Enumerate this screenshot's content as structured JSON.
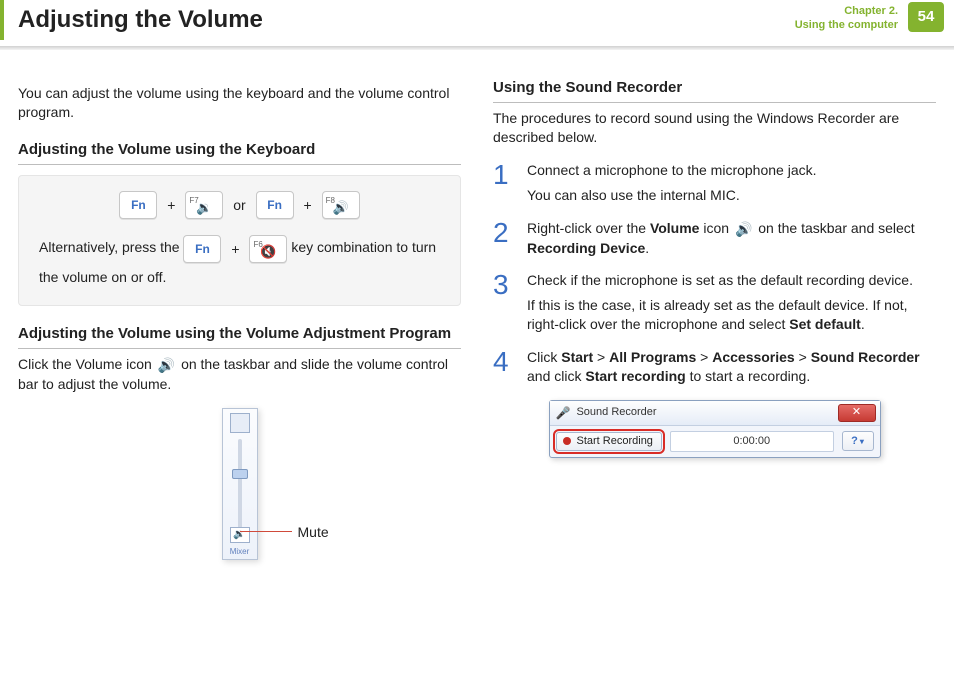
{
  "header": {
    "title": "Adjusting the Volume",
    "chapter_line1": "Chapter 2.",
    "chapter_line2": "Using the computer",
    "page": "54"
  },
  "left": {
    "intro": "You can adjust the volume using the keyboard and the volume control program.",
    "h1": "Adjusting the Volume using the Keyboard",
    "keys": {
      "fn": "Fn",
      "f7": "F7",
      "f8": "F8",
      "f6": "F6",
      "plus": "+",
      "or": "or"
    },
    "alt_pre": "Alternatively, press the ",
    "alt_post": " key combination to turn the volume on or off.",
    "h2": "Adjusting the Volume using the Volume Adjustment Program",
    "prog_pre": "Click the Volume icon ",
    "prog_post": " on the taskbar and slide the volume control bar to adjust the volume.",
    "mixer": "Mixer",
    "mute": "Mute"
  },
  "right": {
    "h1": "Using the Sound Recorder",
    "intro": "The procedures to record sound using the Windows Recorder are described below.",
    "steps": {
      "s1a": "Connect a microphone to the microphone jack.",
      "s1b": "You can also use the internal MIC.",
      "s2_pre": "Right-click over the ",
      "s2_vol": "Volume",
      "s2_mid": " icon ",
      "s2_post": " on the taskbar and select ",
      "s2_rd": "Recording Device",
      "s2_end": ".",
      "s3a": "Check if the microphone is set as the default recording device.",
      "s3b_pre": "If this is the case, it is already set as the default device. If not, right-click over the microphone and select ",
      "s3b_sd": "Set default",
      "s3b_end": ".",
      "s4_pre": "Click ",
      "s4_p1": "Start",
      "gt": " > ",
      "s4_p2": "All Programs",
      "s4_p3": "Accessories",
      "s4_p4": "Sound Recorder",
      "s4_mid": " and click ",
      "s4_p5": "Start recording",
      "s4_end": " to start a recording."
    },
    "nums": {
      "n1": "1",
      "n2": "2",
      "n3": "3",
      "n4": "4"
    },
    "recorder": {
      "title": "Sound Recorder",
      "button": "Start Recording",
      "time": "0:00:00",
      "help": "?"
    }
  },
  "icons": {
    "speaker": "🔊",
    "speaker_down": "🔉",
    "speaker_mute": "🔇",
    "close": "✕",
    "dropdown": "▾",
    "mic": "🎤"
  }
}
